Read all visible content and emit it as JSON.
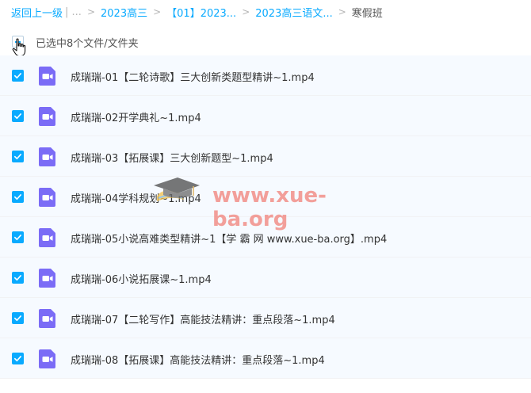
{
  "breadcrumb": {
    "back": "返回上一级",
    "more": "| ...",
    "items": [
      "2023高三",
      "【01】2023...",
      "2023高三语文...",
      "寒假班"
    ]
  },
  "selection": {
    "text": "已选中8个文件/文件夹"
  },
  "files": [
    "成瑞瑞-01【二轮诗歌】三大创新类题型精讲~1.mp4",
    "成瑞瑞-02开学典礼~1.mp4",
    "成瑞瑞-03【拓展课】三大创新题型~1.mp4",
    "成瑞瑞-04学科规划~1.mp4",
    "成瑞瑞-05小说高难类型精讲~1【学 霸 网 www.xue-ba.org】.mp4",
    "成瑞瑞-06小说拓展课~1.mp4",
    "成瑞瑞-07【二轮写作】高能技法精讲：重点段落~1.mp4",
    "成瑞瑞-08【拓展课】高能技法精讲：重点段落~1.mp4"
  ],
  "watermark": {
    "text": "www.xue-ba.org"
  },
  "colors": {
    "accent": "#09AAFF",
    "video_icon": "#7B6CF6",
    "row_selected": "#f6faff"
  },
  "icons": {
    "checkbox": "check-icon",
    "file": "video-file-icon",
    "cursor": "hand-cursor-icon"
  }
}
